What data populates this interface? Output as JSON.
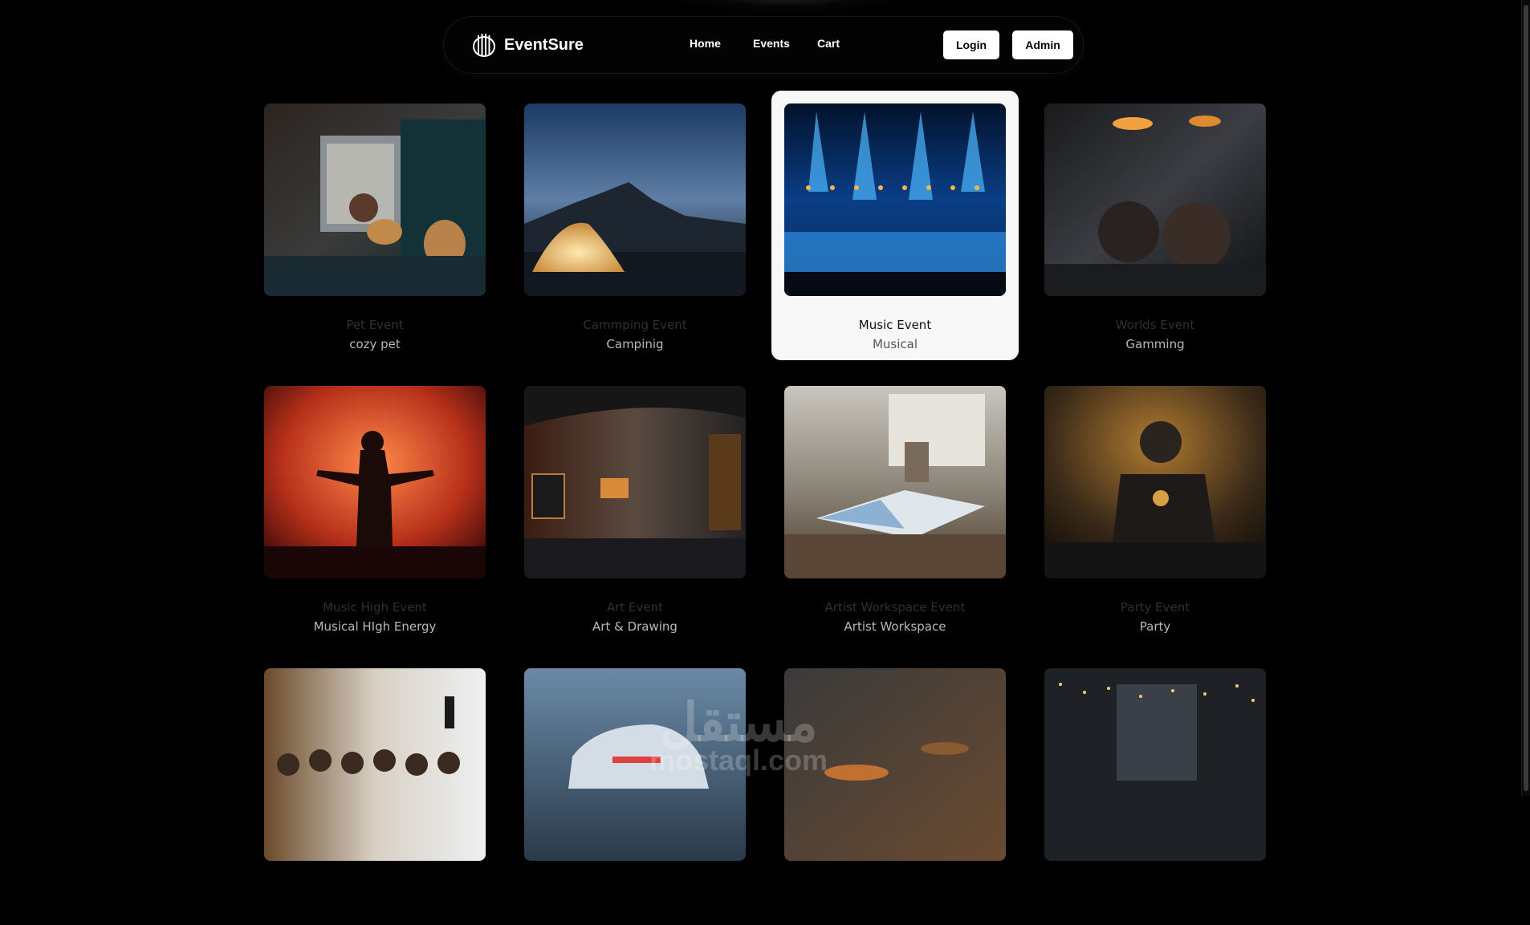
{
  "nav": {
    "brand": "EventSure",
    "links": [
      "Home",
      "Events",
      "Cart"
    ],
    "login": "Login",
    "admin": "Admin"
  },
  "events": [
    {
      "title": "Pet Event",
      "subtitle": "cozy pet"
    },
    {
      "title": "Cammping Event",
      "subtitle": "Campinig"
    },
    {
      "title": "Music Event",
      "subtitle": "Musical"
    },
    {
      "title": "Worlds Event",
      "subtitle": "Gamming"
    },
    {
      "title": "Music High Event",
      "subtitle": "Musical HIgh Energy"
    },
    {
      "title": "Art Event",
      "subtitle": "Art & Drawing"
    },
    {
      "title": "Artist Workspace Event",
      "subtitle": "Artist Workspace"
    },
    {
      "title": "Party Event",
      "subtitle": "Party"
    },
    {
      "title": "",
      "subtitle": ""
    },
    {
      "title": "",
      "subtitle": ""
    },
    {
      "title": "",
      "subtitle": ""
    },
    {
      "title": "",
      "subtitle": ""
    }
  ],
  "watermark": {
    "arabic": "مستقل",
    "latin": "mostaql.com"
  }
}
